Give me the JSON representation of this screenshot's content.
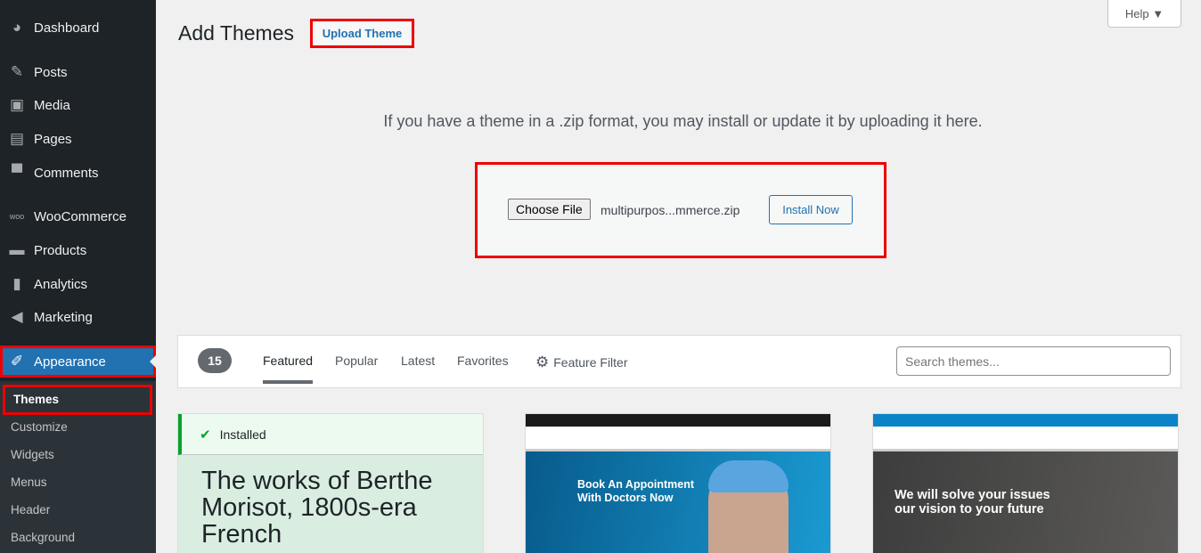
{
  "sidebar": {
    "items": [
      {
        "label": "Dashboard",
        "icon": "dashboard-icon"
      },
      {
        "label": "Posts",
        "icon": "pin-icon"
      },
      {
        "label": "Media",
        "icon": "media-icon"
      },
      {
        "label": "Pages",
        "icon": "pages-icon"
      },
      {
        "label": "Comments",
        "icon": "comment-icon"
      },
      {
        "label": "WooCommerce",
        "icon": "woo-icon"
      },
      {
        "label": "Products",
        "icon": "archive-icon"
      },
      {
        "label": "Analytics",
        "icon": "bar-chart-icon"
      },
      {
        "label": "Marketing",
        "icon": "megaphone-icon"
      },
      {
        "label": "Appearance",
        "icon": "paintbrush-icon"
      }
    ],
    "submenu": [
      "Themes",
      "Customize",
      "Widgets",
      "Menus",
      "Header",
      "Background"
    ]
  },
  "header": {
    "title": "Add Themes",
    "upload_label": "Upload Theme",
    "help_label": "Help ▼"
  },
  "upload": {
    "description": "If you have a theme in a .zip format, you may install or update it by uploading it here.",
    "choose_label": "Choose File",
    "file_name": "multipurpos...mmerce.zip",
    "install_label": "Install Now"
  },
  "filter": {
    "count": "15",
    "tabs": [
      "Featured",
      "Popular",
      "Latest",
      "Favorites"
    ],
    "feature_filter": "Feature Filter",
    "search_placeholder": "Search themes..."
  },
  "themes": [
    {
      "status": "Installed",
      "preview_text": "The works of Berthe Morisot, 1800s-era French"
    },
    {
      "headline": "Book An Appointment With Doctors Now"
    },
    {
      "headline": "We will solve your issues our vision to your future"
    }
  ],
  "colors": {
    "accent": "#2271b1",
    "highlight": "#ee0000",
    "sidebar": "#1d2327"
  }
}
